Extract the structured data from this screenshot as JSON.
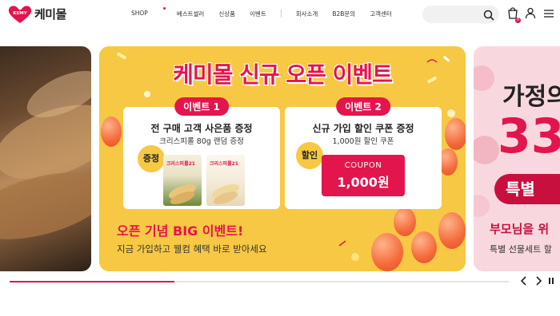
{
  "brand": {
    "name": "케미몰",
    "mark_text": "KEMY",
    "color": "#e3154d"
  },
  "nav": {
    "items": [
      {
        "label": "SHOP",
        "new_dot": true
      },
      {
        "label": "베스트셀러"
      },
      {
        "label": "신상품"
      },
      {
        "label": "이벤트"
      },
      {
        "label": "회사소개"
      },
      {
        "label": "B2B문의"
      },
      {
        "label": "고객센터"
      }
    ]
  },
  "search": {
    "placeholder": "",
    "icon": "search-icon"
  },
  "header_icons": {
    "cart": "cart-icon",
    "cart_badge": "0",
    "user": "user-icon",
    "menu": "menu-icon"
  },
  "banner": {
    "title": "케미몰 신규 오픈 이벤트",
    "event1": {
      "tag": "이벤트 1",
      "title": "전 구매 고객 사은품 증정",
      "subtitle": "크리스피롤 80g 랜덤 증정",
      "badge": "증정",
      "product1_text": "크리스피롤21",
      "product2_text": "크리스피롤21"
    },
    "event2": {
      "tag": "이벤트 2",
      "title": "신규 가입 할인 쿠폰 증정",
      "subtitle": "1,000원 할인 쿠폰",
      "badge": "할인",
      "coupon_label": "COUPON",
      "coupon_value": "1,000원"
    },
    "big_event": "오픈 기념 BIG 이벤트!",
    "big_event_sub": "지금 가입하고 웰컴 혜택 바로 받아세요"
  },
  "right_slide": {
    "line1": "가정의",
    "line2": "33",
    "line3": "특별",
    "line4": "부모님을 위",
    "line5": "특별 선물세트 할"
  },
  "slider": {
    "progress": 0.33,
    "prev_icon": "chevron-left-icon",
    "next_icon": "chevron-right-icon",
    "pause_icon": "pause-icon"
  }
}
